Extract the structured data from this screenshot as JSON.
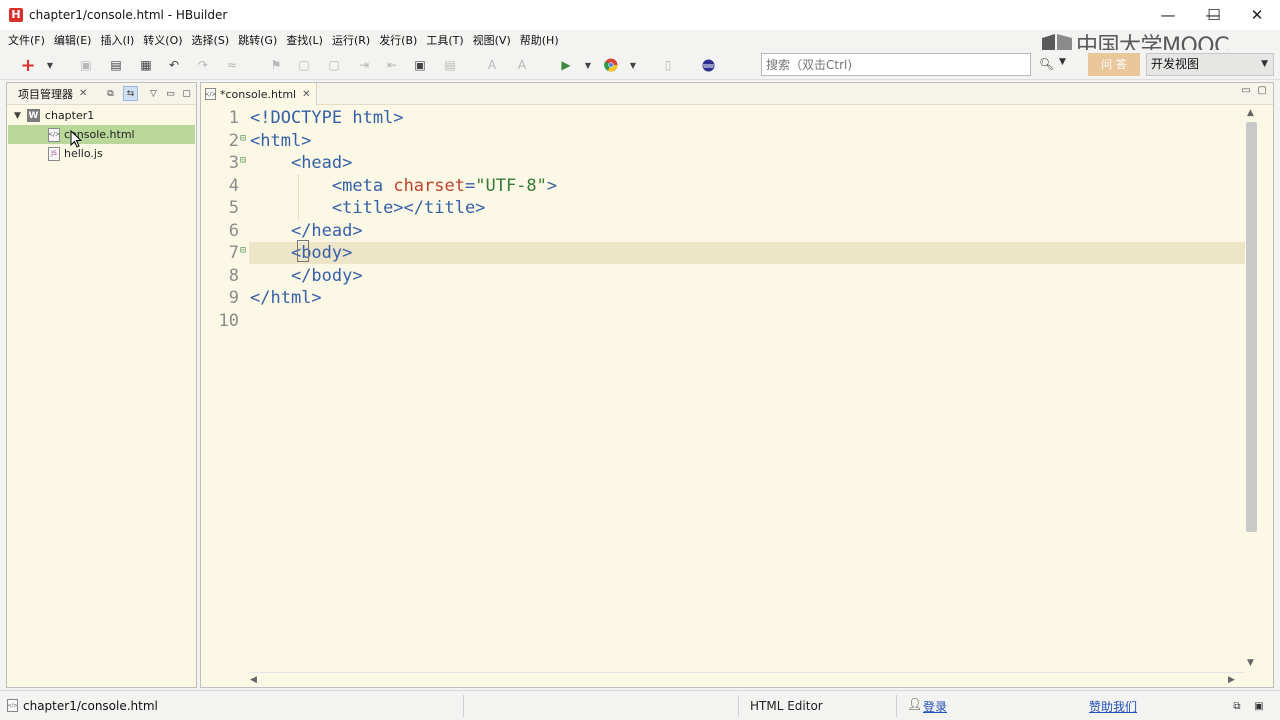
{
  "window": {
    "title": "chapter1/console.html  -  HBuilder",
    "logo_letter": "H",
    "controls": [
      "—",
      "☐",
      "✕"
    ]
  },
  "menu": [
    "文件(F)",
    "编辑(E)",
    "插入(I)",
    "转义(O)",
    "选择(S)",
    "跳转(G)",
    "查找(L)",
    "运行(R)",
    "发行(B)",
    "工具(T)",
    "视图(V)",
    "帮助(H)"
  ],
  "toolbar": {
    "search_placeholder": "搜索（双击Ctrl)",
    "ask_label": "问 答",
    "view_label": "开发视图",
    "new_label": "+"
  },
  "watermark": {
    "text": "中国大学MOOC"
  },
  "project": {
    "header": "项目管理器",
    "root": "chapter1",
    "root_icon": "W",
    "files": [
      {
        "name": "console.html",
        "icon": "html",
        "selected": true
      },
      {
        "name": "hello.js",
        "icon": "JS",
        "selected": false
      }
    ]
  },
  "editor": {
    "tab_label": "*console.html",
    "current_line": 7,
    "lines": [
      {
        "num": "1",
        "html": "<span class=\"tag\">&lt;!DOCTYPE html&gt;</span>"
      },
      {
        "num": "2",
        "html": "<span class=\"tag\">&lt;html&gt;</span>",
        "fold": true
      },
      {
        "num": "3",
        "html": "    <span class=\"tag\">&lt;head&gt;</span>",
        "fold": true
      },
      {
        "num": "4",
        "html": "        <span class=\"tag\">&lt;meta</span> <span class=\"attr\">charset</span><span class=\"tag\">=</span><span class=\"str\">\"UTF-8\"</span><span class=\"tag\">&gt;</span>"
      },
      {
        "num": "5",
        "html": "        <span class=\"tag\">&lt;title&gt;&lt;/title&gt;</span>"
      },
      {
        "num": "6",
        "html": "    <span class=\"tag\">&lt;/head&gt;</span>"
      },
      {
        "num": "7",
        "html": "    <span class=\"tag\">&lt;body&gt;</span>",
        "fold": true
      },
      {
        "num": "8",
        "html": "    <span class=\"tag\">&lt;/body&gt;</span>"
      },
      {
        "num": "9",
        "html": "<span class=\"tag\">&lt;/html&gt;</span>"
      },
      {
        "num": "10",
        "html": ""
      }
    ]
  },
  "status": {
    "path": "chapter1/console.html",
    "editor_type": "HTML Editor",
    "login": "登录",
    "support": "赞助我们"
  }
}
